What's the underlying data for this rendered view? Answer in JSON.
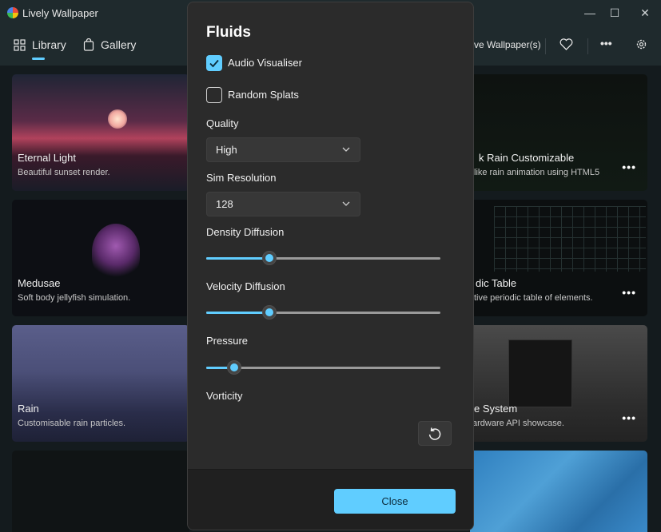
{
  "app": {
    "title": "Lively Wallpaper",
    "logo_icon": "lively-logo-icon"
  },
  "window": {
    "minimize": "—",
    "maximize": "☐",
    "close": "✕"
  },
  "nav": {
    "library": "Library",
    "gallery": "Gallery",
    "active_wallpapers": "ve Wallpaper(s)"
  },
  "cards": [
    {
      "title": "Eternal Light",
      "desc": "Beautiful sunset render."
    },
    {
      "title": "k Rain Customizable",
      "desc": "like rain animation using HTML5"
    },
    {
      "title": "Medusae",
      "desc": "Soft body jellyfish simulation."
    },
    {
      "title": "dic Table",
      "desc": "tive periodic table of elements."
    },
    {
      "title": "Rain",
      "desc": "Customisable rain particles."
    },
    {
      "title": "e System",
      "desc": "ardware API showcase."
    }
  ],
  "card_menu_glyph": "•••",
  "dialog": {
    "title": "Fluids",
    "audio_visualiser": {
      "label": "Audio Visualiser",
      "checked": true
    },
    "random_splats": {
      "label": "Random Splats",
      "checked": false
    },
    "quality": {
      "label": "Quality",
      "value": "High"
    },
    "sim_resolution": {
      "label": "Sim Resolution",
      "value": "128"
    },
    "density_diffusion": {
      "label": "Density Diffusion",
      "fraction": 0.27
    },
    "velocity_diffusion": {
      "label": "Velocity Diffusion",
      "fraction": 0.27
    },
    "pressure": {
      "label": "Pressure",
      "fraction": 0.12
    },
    "vorticity": {
      "label": "Vorticity"
    },
    "close_label": "Close"
  },
  "colors": {
    "accent": "#60cdff",
    "dialog_bg": "#2b2b2b",
    "content_bg": "#141b1e"
  }
}
